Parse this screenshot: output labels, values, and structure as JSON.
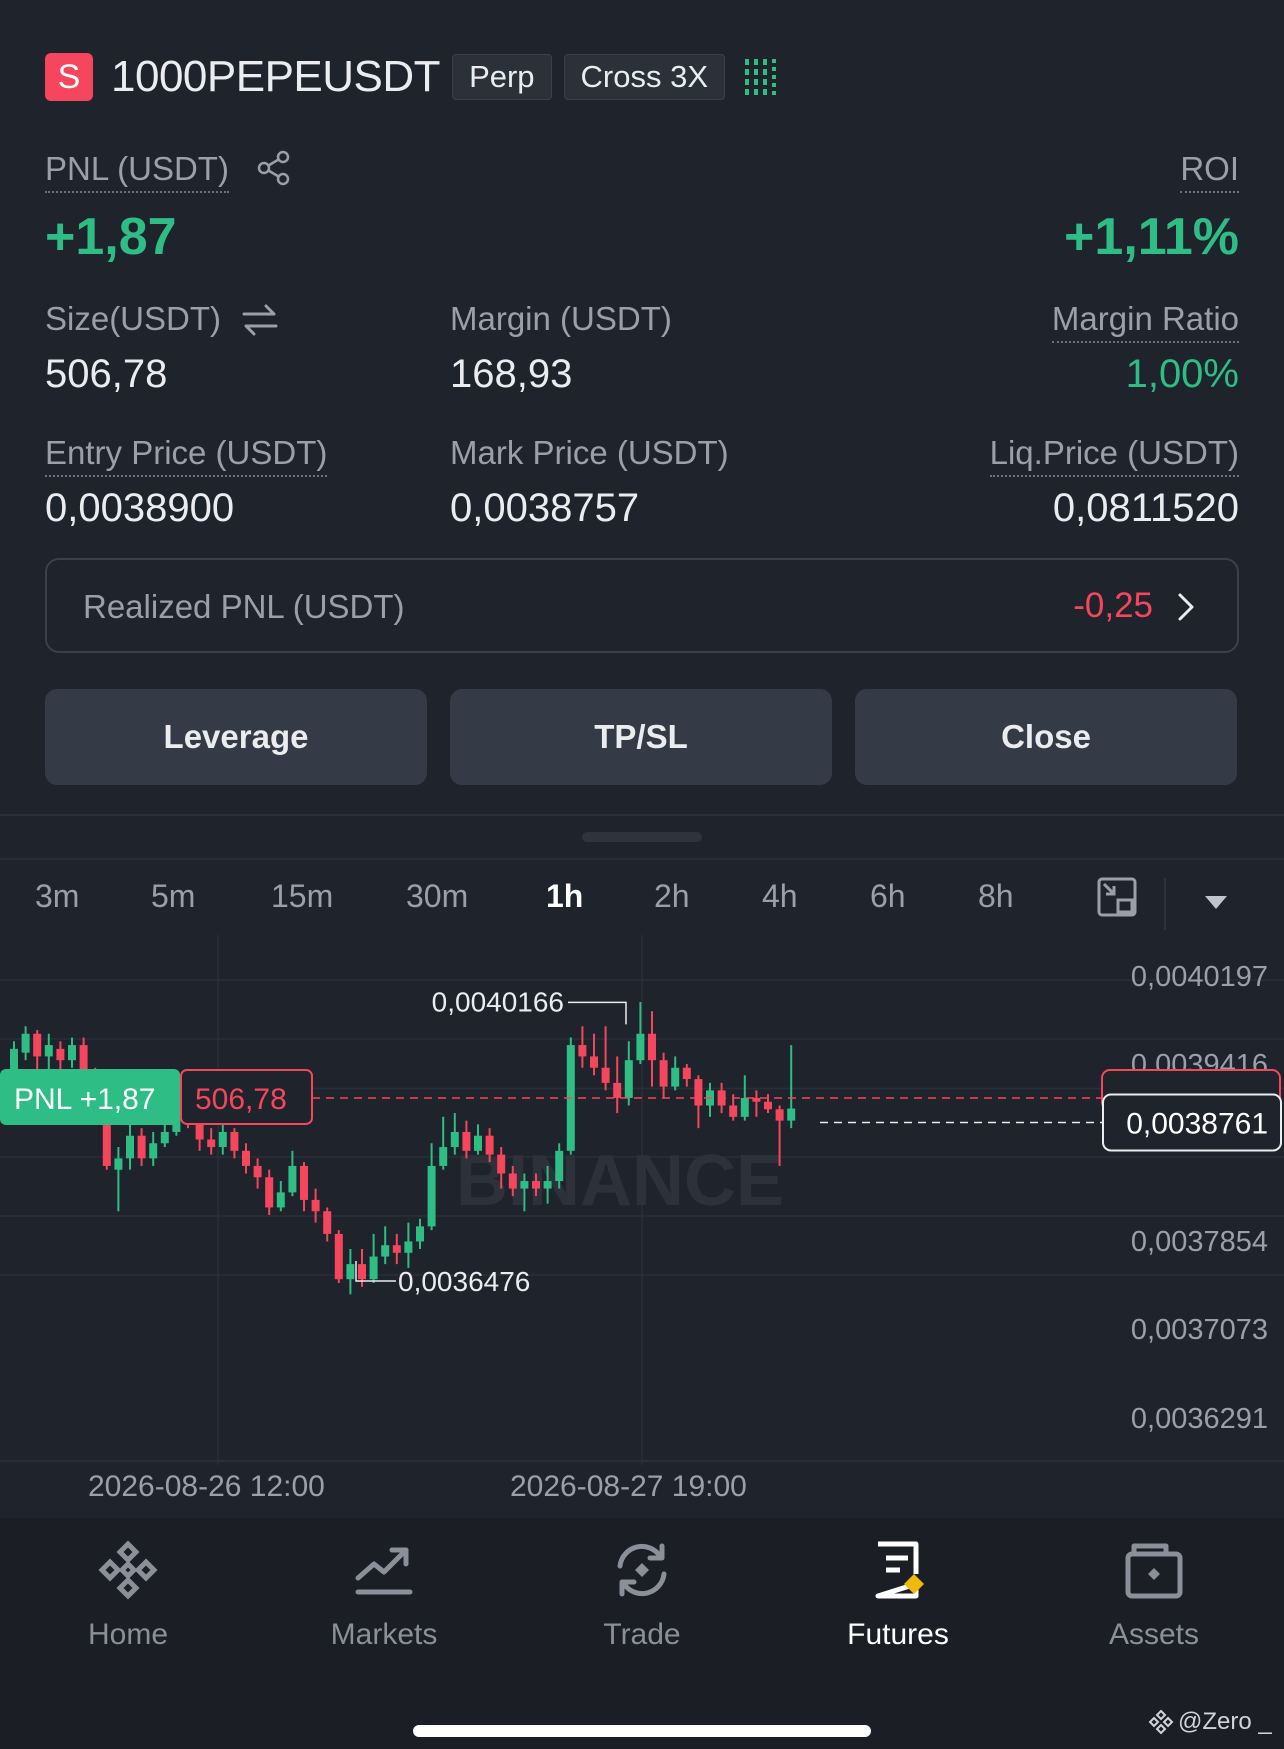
{
  "header": {
    "side_badge": "S",
    "symbol": "1000PEPEUSDT",
    "contract_type": "Perp",
    "margin_mode": "Cross 3X"
  },
  "position": {
    "pnl_label": "PNL (USDT)",
    "pnl_value": "+1,87",
    "roi_label": "ROI",
    "roi_value": "+1,11%",
    "size_label": "Size(USDT)",
    "size_value": "506,78",
    "margin_label": "Margin (USDT)",
    "margin_value": "168,93",
    "margin_ratio_label": "Margin Ratio",
    "margin_ratio_value": "1,00%",
    "entry_label": "Entry Price (USDT)",
    "entry_value": "0,0038900",
    "mark_label": "Mark Price (USDT)",
    "mark_value": "0,0038757",
    "liq_label": "Liq.Price (USDT)",
    "liq_value": "0,0811520",
    "realized_label": "Realized PNL (USDT)",
    "realized_value": "-0,25"
  },
  "actions": {
    "leverage": "Leverage",
    "tpsl": "TP/SL",
    "close": "Close"
  },
  "timeframes": [
    "3m",
    "5m",
    "15m",
    "30m",
    "1h",
    "2h",
    "4h",
    "6h",
    "8h"
  ],
  "active_timeframe": "1h",
  "chart": {
    "y_ticks": [
      "0,0040197",
      "0,0039416",
      "0,0038761",
      "0,0037854",
      "0,0037073",
      "0,0036291"
    ],
    "x_ticks": [
      "2026-08-26 12:00",
      "2026-08-27 19:00"
    ],
    "high_marker": "0,0040166",
    "low_marker": "0,0036476",
    "current_price": "0,0038761",
    "pnl_tag": "PNL +1,87",
    "size_tag": "506,78",
    "watermark": "BINANCE",
    "colors": {
      "up": "#2ebd85",
      "down": "#f6465d"
    }
  },
  "nav": {
    "items": [
      {
        "label": "Home",
        "icon": "binance-logo-icon"
      },
      {
        "label": "Markets",
        "icon": "chart-trend-icon"
      },
      {
        "label": "Trade",
        "icon": "trade-swap-icon"
      },
      {
        "label": "Futures",
        "icon": "futures-doc-icon"
      },
      {
        "label": "Assets",
        "icon": "wallet-icon"
      }
    ],
    "active": "Futures"
  },
  "watermark_credit": "@Zero _"
}
